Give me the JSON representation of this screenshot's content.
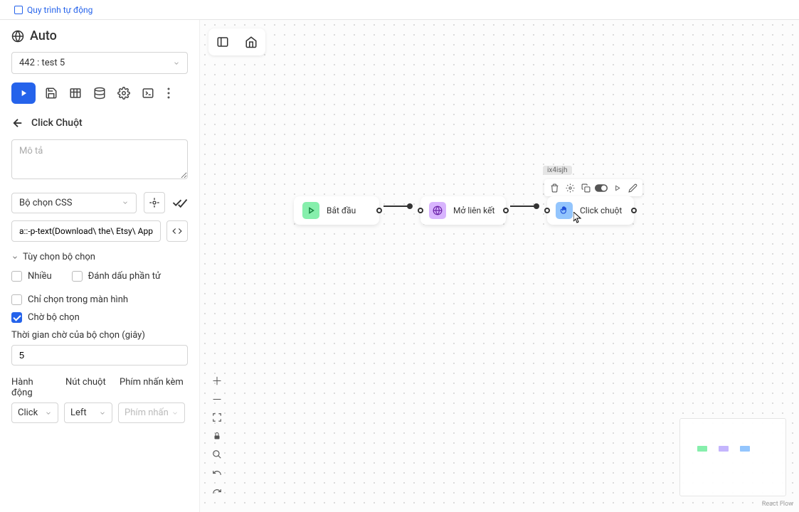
{
  "tab": {
    "label": "Quy trình tự động"
  },
  "workspace": {
    "title": "Auto"
  },
  "workflow_select": {
    "label": "442 : test 5"
  },
  "node_panel": {
    "title": "Click Chuột",
    "desc_placeholder": "Mô tả",
    "selector_type": "Bộ chọn CSS",
    "selector_value": "a::-p-text(Download\\ the\\ Etsy\\ App)",
    "options_header": "Tùy chọn bộ chọn",
    "opt_multiple": "Nhiều",
    "opt_mark": "Đánh dấu phần tử",
    "opt_visible": "Chỉ chọn trong màn hình",
    "opt_wait": "Chờ bộ chọn",
    "wait_label": "Thời gian chờ của bộ chọn (giây)",
    "wait_value": "5",
    "labels": {
      "action": "Hành động",
      "button": "Nút chuột",
      "keys": "Phím nhấn kèm"
    },
    "action_value": "Click",
    "button_value": "Left",
    "keys_placeholder": "Phím nhấn"
  },
  "canvas": {
    "nodes": {
      "start": "Bắt đầu",
      "open": "Mở liên kết",
      "click": "Click chuột"
    },
    "selected_id": "ix4isjh",
    "attribution": "React Flow"
  }
}
